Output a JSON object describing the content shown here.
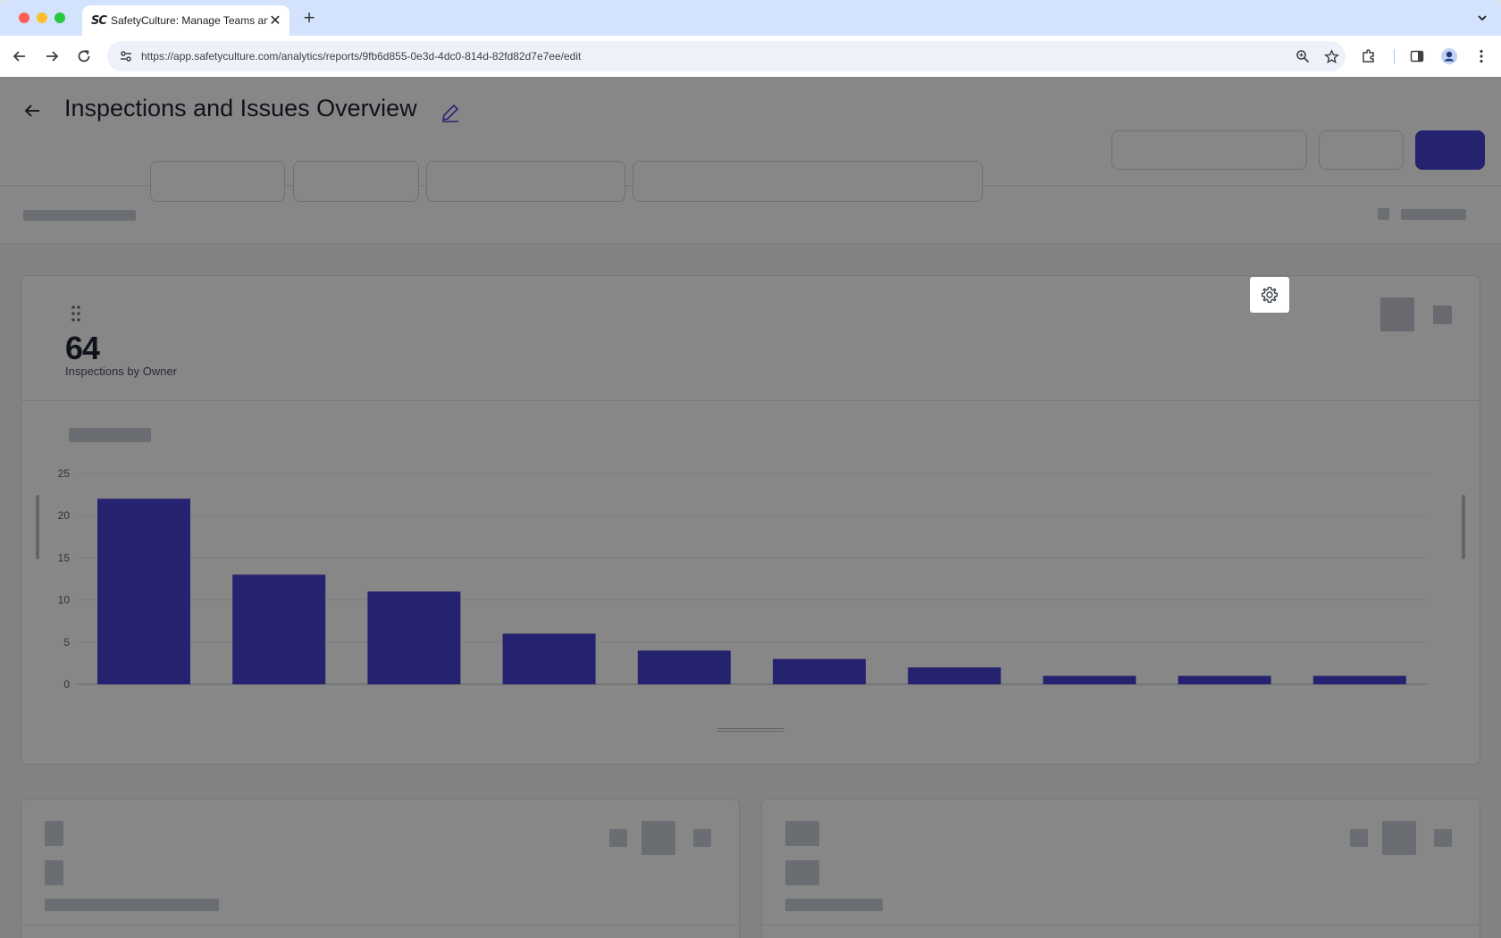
{
  "browser": {
    "tab_title": "SafetyCulture: Manage Teams and...",
    "favicon_text": "SC",
    "url": "https://app.safetyculture.com/analytics/reports/9fb6d855-0e3d-4dc0-814d-82fd82d7e7ee/edit"
  },
  "header": {
    "title": "Inspections and Issues Overview"
  },
  "widget": {
    "metric_value": "64",
    "metric_label": "Inspections by Owner"
  },
  "chart_data": {
    "type": "bar",
    "title": "",
    "xlabel": "",
    "ylabel": "",
    "ylim": [
      0,
      25
    ],
    "yticks": [
      0,
      5,
      10,
      15,
      20,
      25
    ],
    "grid": true,
    "bar_color": "#4740d4",
    "categories": [
      "",
      "",
      "",
      "",
      "",
      "",
      "",
      "",
      "",
      ""
    ],
    "values": [
      22,
      13,
      11,
      6,
      4,
      3,
      2,
      1,
      1,
      1
    ]
  }
}
